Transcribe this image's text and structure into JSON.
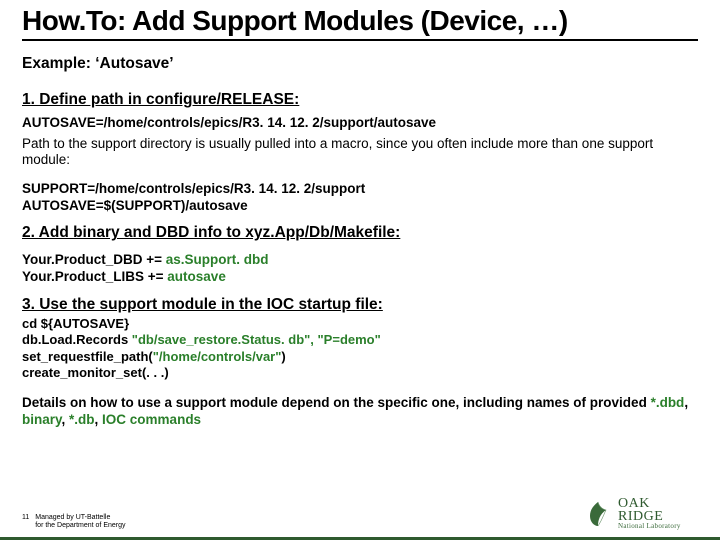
{
  "title": "How.To: Add Support Modules (Device, …)",
  "example": "Example: ‘Autosave’",
  "step1": {
    "heading": "1. Define path in configure/RELEASE:",
    "code1": "AUTOSAVE=/home/controls/epics/R3. 14. 12. 2/support/autosave",
    "note": "Path to the support directory is usually pulled into a macro, since you often include more than one support module:",
    "code2a": "SUPPORT=/home/controls/epics/R3. 14. 12. 2/support",
    "code2b": "AUTOSAVE=$(SUPPORT)/autosave"
  },
  "step2": {
    "heading": "2. Add binary and DBD info to xyz.App/Db/Makefile:",
    "l1a": "Your.Product_DBD += ",
    "l1b": "as.Support. dbd",
    "l2a": "Your.Product_LIBS += ",
    "l2b": "autosave"
  },
  "step3": {
    "heading": "3. Use the support module in the IOC startup file:",
    "l1": "cd ${AUTOSAVE}",
    "l2a": "db.Load.Records ",
    "l2b": "\"db/save_restore.Status. db\", \"P=demo\"",
    "l3a": "set_requestfile_path(",
    "l3b": "\"/home/controls/var\"",
    "l3c": ")",
    "l4a": "create_monitor_set(",
    "l4b": ". . .",
    "l4c": ")"
  },
  "details": {
    "pre": "Details on how to use a support module depend on the specific one, including names of provided ",
    "g1": "*.dbd",
    "s1": ", ",
    "g2": "binary",
    "s2": ", ",
    "g3": "*.db",
    "s3": ", ",
    "g4": "IOC commands"
  },
  "footer": {
    "page": "11",
    "line1": "Managed by UT-Battelle",
    "line2": "for the Department of Energy"
  },
  "logo": {
    "oak": "OAK",
    "ridge": "RIDGE",
    "nl": "National Laboratory"
  }
}
